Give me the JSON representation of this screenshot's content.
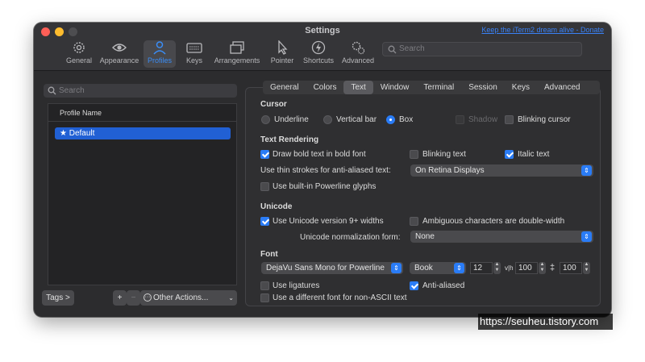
{
  "window": {
    "title": "Settings",
    "donate_link": "Keep the iTerm2 dream alive - Donate"
  },
  "toolbar": {
    "items": [
      {
        "label": "General",
        "icon": "gear-icon"
      },
      {
        "label": "Appearance",
        "icon": "eye-icon"
      },
      {
        "label": "Profiles",
        "icon": "person-icon",
        "active": true
      },
      {
        "label": "Keys",
        "icon": "keyboard-icon"
      },
      {
        "label": "Arrangements",
        "icon": "windows-icon"
      },
      {
        "label": "Pointer",
        "icon": "cursor-icon"
      },
      {
        "label": "Shortcuts",
        "icon": "bolt-icon"
      },
      {
        "label": "Advanced",
        "icon": "gears-icon"
      }
    ],
    "search_placeholder": "Search"
  },
  "sidebar": {
    "search_placeholder": "Search",
    "column_header": "Profile Name",
    "profiles": [
      {
        "name": "★ Default",
        "selected": true
      }
    ],
    "tags_button": "Tags >",
    "add_button": "+",
    "remove_button": "−",
    "other_actions": "Other Actions..."
  },
  "tabs": [
    "General",
    "Colors",
    "Text",
    "Window",
    "Terminal",
    "Session",
    "Keys",
    "Advanced"
  ],
  "active_tab": "Text",
  "cursor": {
    "heading": "Cursor",
    "underline": "Underline",
    "vertical_bar": "Vertical bar",
    "box": "Box",
    "shadow": "Shadow",
    "blinking": "Blinking cursor"
  },
  "text_rendering": {
    "heading": "Text Rendering",
    "bold": "Draw bold text in bold font",
    "blinking_text": "Blinking text",
    "italic": "Italic text",
    "thin_strokes_label": "Use thin strokes for anti-aliased text:",
    "thin_strokes_value": "On Retina Displays",
    "powerline": "Use built-in Powerline glyphs"
  },
  "unicode": {
    "heading": "Unicode",
    "version9": "Use Unicode version 9+ widths",
    "ambiguous": "Ambiguous characters are double-width",
    "normalization_label": "Unicode normalization form:",
    "normalization_value": "None"
  },
  "font": {
    "heading": "Font",
    "family": "DejaVu Sans Mono for Powerline",
    "weight": "Book",
    "size": "12",
    "vh_label": "v|h",
    "vh_value": "100",
    "spacing_value": "100",
    "ligatures": "Use ligatures",
    "anti_aliased": "Anti-aliased",
    "non_ascii": "Use a different font for non-ASCII text"
  },
  "watermark": "https://seuheu.tistory.com",
  "colors": {
    "accent": "#2a7cf6",
    "window_bg": "#2c2c2e",
    "selection": "#2160d4"
  }
}
